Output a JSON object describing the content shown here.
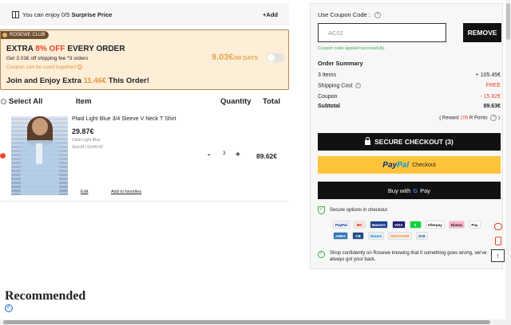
{
  "banner": {
    "prefix": "You can enjoy 0/5",
    "highlight": "Surprise Price",
    "add_label": "+Add"
  },
  "club": {
    "tag": "ROSEWE CLUB",
    "headline_pre": "EXTRA",
    "headline_pct": "8% OFF",
    "headline_post": "EVERY ORDER",
    "shipping": "Get 3.01€ off shipping fee *3 orders",
    "coupon_note": "Coupon can be used together!",
    "price": "9.03€",
    "price_period": "/90 DAYS",
    "join_pre": "Join and Enjoy Extra",
    "join_amount": "11.46€",
    "join_post": "This Order!"
  },
  "table_headers": {
    "select_all": "Select All",
    "item": "Item",
    "quantity": "Quantity",
    "total": "Total"
  },
  "cart_item": {
    "name": "Plaid Light Blue 3/4 Sleeve V Neck T Shirt",
    "price": "29.87€",
    "color": "Color:Light Blue",
    "size": "Size:M | EU40-42",
    "minus": "-",
    "quantity": "3",
    "plus": "+",
    "total": "89.62€",
    "edit": "Edit",
    "favorites": "Add to favorites"
  },
  "recommended": "Recommended",
  "coupon": {
    "label": "Use Coupon Code :",
    "value": "AC02",
    "remove": "REMOVE",
    "success": "Coupon code applied successfully."
  },
  "order_summary": {
    "title": "Order Summary",
    "items_label": "3 Items",
    "items_value": "+ 105.45€",
    "shipping_label": "Shipping Cost",
    "shipping_value": "FREE",
    "coupon_label": "Coupon",
    "coupon_value": "- 15.82€",
    "subtotal_label": "Subtotal",
    "subtotal_value": "89.63€",
    "reward_pre": "( Reward",
    "reward_points": "105",
    "reward_post": "R Points"
  },
  "checkout": {
    "secure_label": "SECURE CHECKOUT (3)",
    "paypal_pay": "Pay",
    "paypal_pal": "Pal",
    "paypal_checkout": "Checkout",
    "gpay_pre": "Buy with",
    "gpay_g": "G",
    "gpay_post": "Pay"
  },
  "secure_options": "Secure options in checkout",
  "payment_methods": [
    {
      "name": "PayPal",
      "color": "#f0f4fb",
      "text_color": "#003087"
    },
    {
      "name": "MC",
      "color": "#f7e9df",
      "text_color": "#eb001b"
    },
    {
      "name": "Maestro",
      "color": "#1a3f8f",
      "text_color": "#ffffff"
    },
    {
      "name": "VISA",
      "color": "#1a1f71",
      "text_color": "#ffffff"
    },
    {
      "name": "$",
      "color": "#00d632",
      "text_color": "#ffffff"
    },
    {
      "name": "Afterpay",
      "color": "#ffffff",
      "text_color": "#111111"
    },
    {
      "name": "Klarna",
      "color": "#ffb3c7",
      "text_color": "#111111"
    },
    {
      "name": "Pay",
      "color": "#ffffff",
      "text_color": "#111111"
    },
    {
      "name": "AMEX",
      "color": "#2e77bc",
      "text_color": "#ffffff"
    },
    {
      "name": "CB",
      "color": "#1f4e8c",
      "text_color": "#ffffff"
    },
    {
      "name": "Diners",
      "color": "#e6eef8",
      "text_color": "#0079be"
    },
    {
      "name": "DISCOVER",
      "color": "#f2f2f2",
      "text_color": "#f48120"
    },
    {
      "name": "JCB",
      "color": "#f2f2f2",
      "text_color": "#0b4ea2"
    }
  ],
  "confidence_text": "Shop confidently on Rosewe knowing that if something goes wrong, we've always got your back.",
  "colors": {
    "accent_red": "#e8462b",
    "accent_orange": "#e8963b",
    "success_green": "#3cb043",
    "paypal_yellow": "#ffc439"
  }
}
